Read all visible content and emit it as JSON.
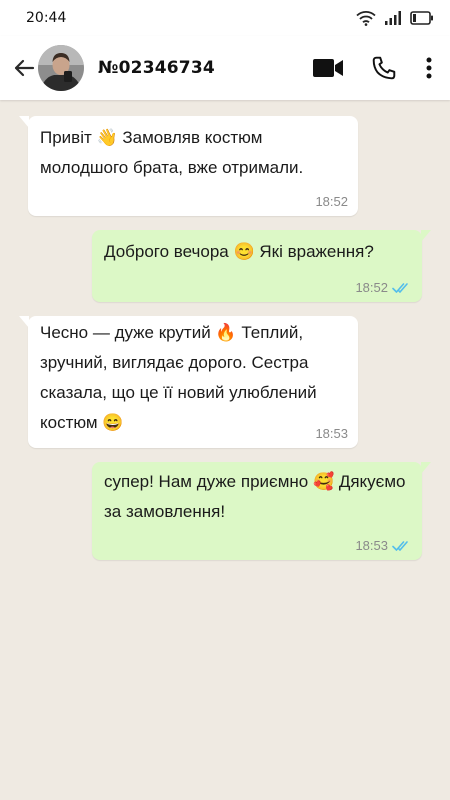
{
  "status_bar": {
    "time": "20:44",
    "icons": [
      "wifi-icon",
      "signal-icon",
      "battery-icon"
    ]
  },
  "header": {
    "contact_name": "№02346734",
    "icons": [
      "back-arrow-icon",
      "video-call-icon",
      "phone-icon",
      "more-vertical-icon"
    ]
  },
  "messages": [
    {
      "direction": "incoming",
      "text": "Привіт 👋 Замовляв костюм молодшого брата, вже отримали.",
      "time": "18:52"
    },
    {
      "direction": "outgoing",
      "text": "Доброго вечора 😊 Які враження?",
      "time": "18:52",
      "status": "read"
    },
    {
      "direction": "incoming",
      "text": "Чесно — дуже крутий 🔥 Теплий, зручний, виглядає дорого. Сестра сказала, що це її новий улюблений костюм 😄",
      "time": "18:53"
    },
    {
      "direction": "outgoing",
      "text": "супер! Нам дуже приємно 🥰 Дякуємо за замовлення!",
      "time": "18:53",
      "status": "read"
    }
  ],
  "colors": {
    "chat_background": "#efeae2",
    "incoming_bubble": "#ffffff",
    "outgoing_bubble": "#dcf8c6",
    "read_ticks": "#53bdeb"
  }
}
